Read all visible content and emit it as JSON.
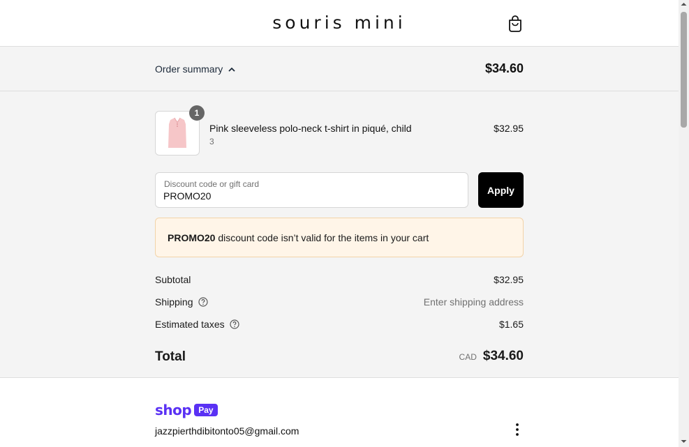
{
  "header": {
    "brand": "souris mini",
    "cart_icon": "shopping-bag-icon"
  },
  "summary_bar": {
    "toggle_label": "Order summary",
    "toggle_icon": "chevron-up-icon",
    "total": "$34.60"
  },
  "item": {
    "quantity": "1",
    "name": "Pink sleeveless polo-neck t-shirt in piqué, child",
    "variant": "3",
    "price": "$32.95",
    "image_color": "#f6c6c8"
  },
  "discount": {
    "label": "Discount code or gift card",
    "value": "PROMO20",
    "apply_label": "Apply"
  },
  "notice": {
    "code": "PROMO20",
    "message": " discount code isn’t valid for the items in your cart"
  },
  "costs": {
    "subtotal_label": "Subtotal",
    "subtotal_value": "$32.95",
    "shipping_label": "Shipping",
    "shipping_value": "Enter shipping address",
    "taxes_label": "Estimated taxes",
    "taxes_value": "$1.65",
    "total_label": "Total",
    "currency": "CAD",
    "total_value": "$34.60"
  },
  "shop_pay": {
    "shop_word": "shop",
    "pay_word": "Pay",
    "email": "jazzpierthdibitonto05@gmail.com",
    "menu_icon": "more-vertical-icon"
  },
  "colors": {
    "shop_pay_purple": "#5a31f4",
    "notice_bg": "#fff5e8",
    "apply_bg": "#000000"
  }
}
